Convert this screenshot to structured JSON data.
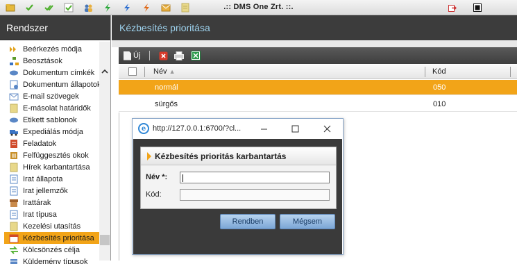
{
  "app": {
    "title": ".:: DMS One Zrt. ::."
  },
  "toolbar_icons": [
    {
      "name": "folder-icon",
      "color": "#e6b93b"
    },
    {
      "name": "check-icon",
      "color": "#4caf2a"
    },
    {
      "name": "double-check-icon",
      "color": "#4caf2a"
    },
    {
      "name": "check-box-icon",
      "color": "#4caf2a"
    },
    {
      "name": "users-icon",
      "color": "#4a78b8"
    },
    {
      "name": "lightning-green-icon",
      "color": "#2aa83a"
    },
    {
      "name": "lightning-blue-icon",
      "color": "#2e6fd0"
    },
    {
      "name": "lightning-orange-icon",
      "color": "#e06a1a"
    },
    {
      "name": "mail-icon",
      "color": "#e8b040"
    },
    {
      "name": "note-icon",
      "color": "#e8d88a"
    }
  ],
  "window_icons": [
    {
      "name": "logout-icon",
      "color": "#cc3333"
    },
    {
      "name": "stop-icon",
      "color": "#111111"
    }
  ],
  "sidebar": {
    "title": "Rendszer",
    "items": [
      {
        "label": "Beérkezés módja",
        "icon": "arrows-icon",
        "color": "#e2a21a"
      },
      {
        "label": "Beosztások",
        "icon": "org-chart-icon",
        "color": "#5a9b2a"
      },
      {
        "label": "Dokumentum címkék",
        "icon": "tag-icon",
        "color": "#5a87c6"
      },
      {
        "label": "Dokumentum állapotok",
        "icon": "document-state-icon",
        "color": "#5a87c6"
      },
      {
        "label": "E-mail szövegek",
        "icon": "email-icon",
        "color": "#6a90c8"
      },
      {
        "label": "E-másolat határidők",
        "icon": "note-icon",
        "color": "#e8d88a"
      },
      {
        "label": "Etikett sablonok",
        "icon": "tag-icon",
        "color": "#5a87c6"
      },
      {
        "label": "Expediálás módja",
        "icon": "truck-icon",
        "color": "#3b74c4"
      },
      {
        "label": "Feladatok",
        "icon": "task-icon",
        "color": "#d04a2a"
      },
      {
        "label": "Felfüggesztés okok",
        "icon": "pause-icon",
        "color": "#c8902a"
      },
      {
        "label": "Hírek karbantartása",
        "icon": "note-icon",
        "color": "#e8d88a"
      },
      {
        "label": "Irat állapota",
        "icon": "document-icon",
        "color": "#5a87c6"
      },
      {
        "label": "Irat jellemzők",
        "icon": "document-icon",
        "color": "#5a87c6"
      },
      {
        "label": "Irattárak",
        "icon": "archive-icon",
        "color": "#a0602a"
      },
      {
        "label": "Irat típusa",
        "icon": "document-icon",
        "color": "#5a87c6"
      },
      {
        "label": "Kezelési utasítás",
        "icon": "note-icon",
        "color": "#e8d88a"
      },
      {
        "label": "Kézbesítés prioritása",
        "icon": "calendar-icon",
        "color": "#d04a2a"
      },
      {
        "label": "Kölcsönzés célja",
        "icon": "exchange-icon",
        "color": "#4caf2a"
      },
      {
        "label": "Küldemény típusok",
        "icon": "package-icon",
        "color": "#5a87c6"
      }
    ],
    "selected_index": 16
  },
  "main": {
    "title": "Kézbesítés prioritása",
    "toolbar": {
      "new_label": "Új"
    },
    "grid": {
      "columns": [
        "Név",
        "Kód"
      ],
      "rows": [
        {
          "name": "normál",
          "code": "050",
          "selected": true
        },
        {
          "name": "sürgős",
          "code": "010",
          "selected": false
        }
      ]
    }
  },
  "popup": {
    "url": "http://127.0.0.1:6700/?cl...",
    "panel_title": "Kézbesítés prioritás karbantartás",
    "fields": [
      {
        "label": "Név *:",
        "value": "",
        "required": true
      },
      {
        "label": "Kód:",
        "value": "",
        "required": false
      }
    ],
    "ok_label": "Rendben",
    "cancel_label": "Mégsem"
  }
}
